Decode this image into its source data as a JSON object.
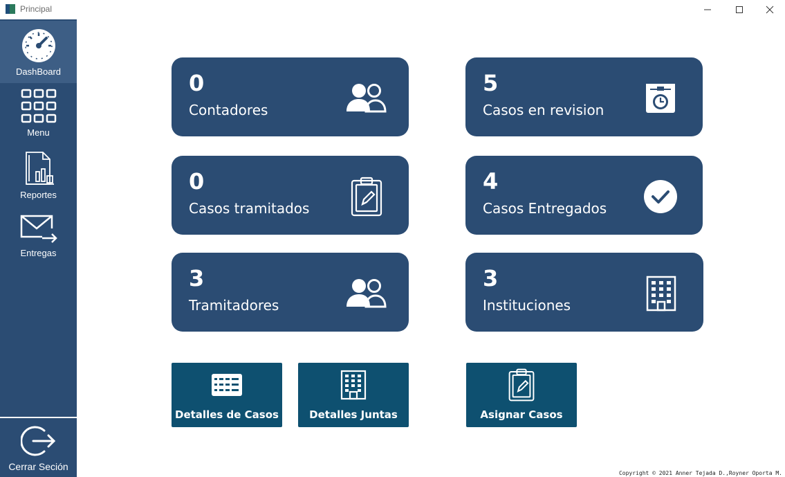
{
  "window": {
    "title": "Principal",
    "icons": [
      "app-icon",
      "minimize-icon",
      "maximize-icon",
      "close-icon"
    ]
  },
  "sidebar": {
    "items": [
      {
        "label": "DashBoard",
        "icon": "dashboard-gauge-icon",
        "active": true
      },
      {
        "label": "Menu",
        "icon": "grid-icon"
      },
      {
        "label": "Reportes",
        "icon": "report-chart-icon"
      },
      {
        "label": "Entregas",
        "icon": "mail-send-icon"
      }
    ],
    "logout": {
      "label": "Cerrar Seción",
      "icon": "logout-icon"
    }
  },
  "cards": [
    {
      "value": "0",
      "label": "Contadores",
      "icon": "users-icon"
    },
    {
      "value": "5",
      "label": "Casos en revision",
      "icon": "calendar-clock-icon"
    },
    {
      "value": "0",
      "label": "Casos tramitados",
      "icon": "clipboard-edit-icon"
    },
    {
      "value": "4",
      "label": "Casos Entregados",
      "icon": "check-circle-icon"
    },
    {
      "value": "3",
      "label": "Tramitadores",
      "icon": "users-icon"
    },
    {
      "value": "3",
      "label": "Instituciones",
      "icon": "building-icon"
    }
  ],
  "actions": [
    {
      "label": "Detalles de Casos",
      "icon": "table-list-icon"
    },
    {
      "label": "Detalles Juntas",
      "icon": "building-icon"
    },
    {
      "label": "Asignar Casos",
      "icon": "clipboard-edit-icon"
    }
  ],
  "footer": {
    "copyright": "Copyright © 2021 Anner Tejada D.,Royner Oporta M."
  },
  "colors": {
    "sidebar": "#2b4c73",
    "sidebar_active": "#3d5e85",
    "card": "#2b4c73",
    "action": "#0e5070",
    "text_light": "#ffffff"
  }
}
